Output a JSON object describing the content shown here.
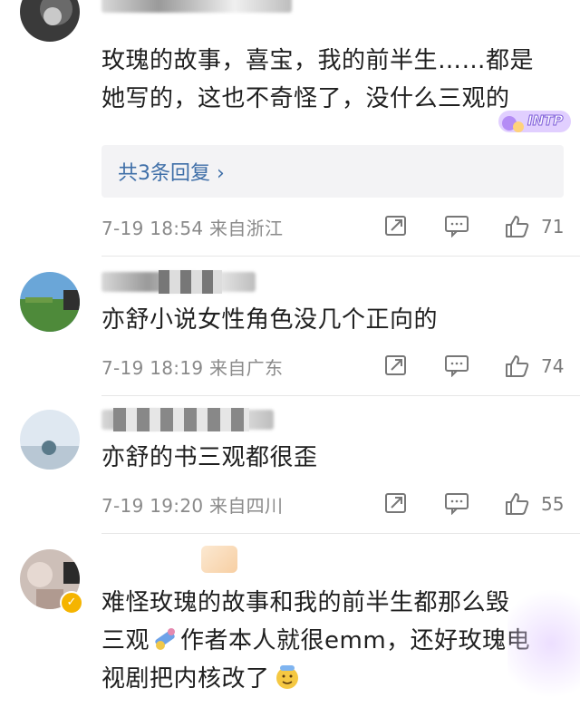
{
  "comments": [
    {
      "text_lines": [
        "玫瑰的故事，喜宝，我的前半生……都是",
        "她写的，这也不奇怪了，没什么三观的"
      ],
      "reply_label": "共3条回复 ›",
      "time": "7-19 18:54 来自浙江",
      "likes": "71"
    },
    {
      "text_lines": [
        "亦舒小说女性角色没几个正向的"
      ],
      "time": "7-19 18:19 来自广东",
      "likes": "74"
    },
    {
      "text_lines": [
        "亦舒的书三观都很歪"
      ],
      "time": "7-19 19:20 来自四川",
      "likes": "55"
    },
    {
      "text_lines": [
        "难怪玫瑰的故事和我的前半生都那么毁",
        "三观",
        "作者本人就很emm，还好玫瑰电",
        "视剧把内核改了"
      ]
    }
  ],
  "icons": {
    "share": "share-icon",
    "comment": "comment-icon",
    "like": "thumbs-up-icon"
  },
  "stickers": {
    "intp_label": "INTP"
  },
  "colors": {
    "link": "#3f6fa8",
    "meta": "#8a8a8a",
    "reply_bg": "#f3f3f5"
  }
}
